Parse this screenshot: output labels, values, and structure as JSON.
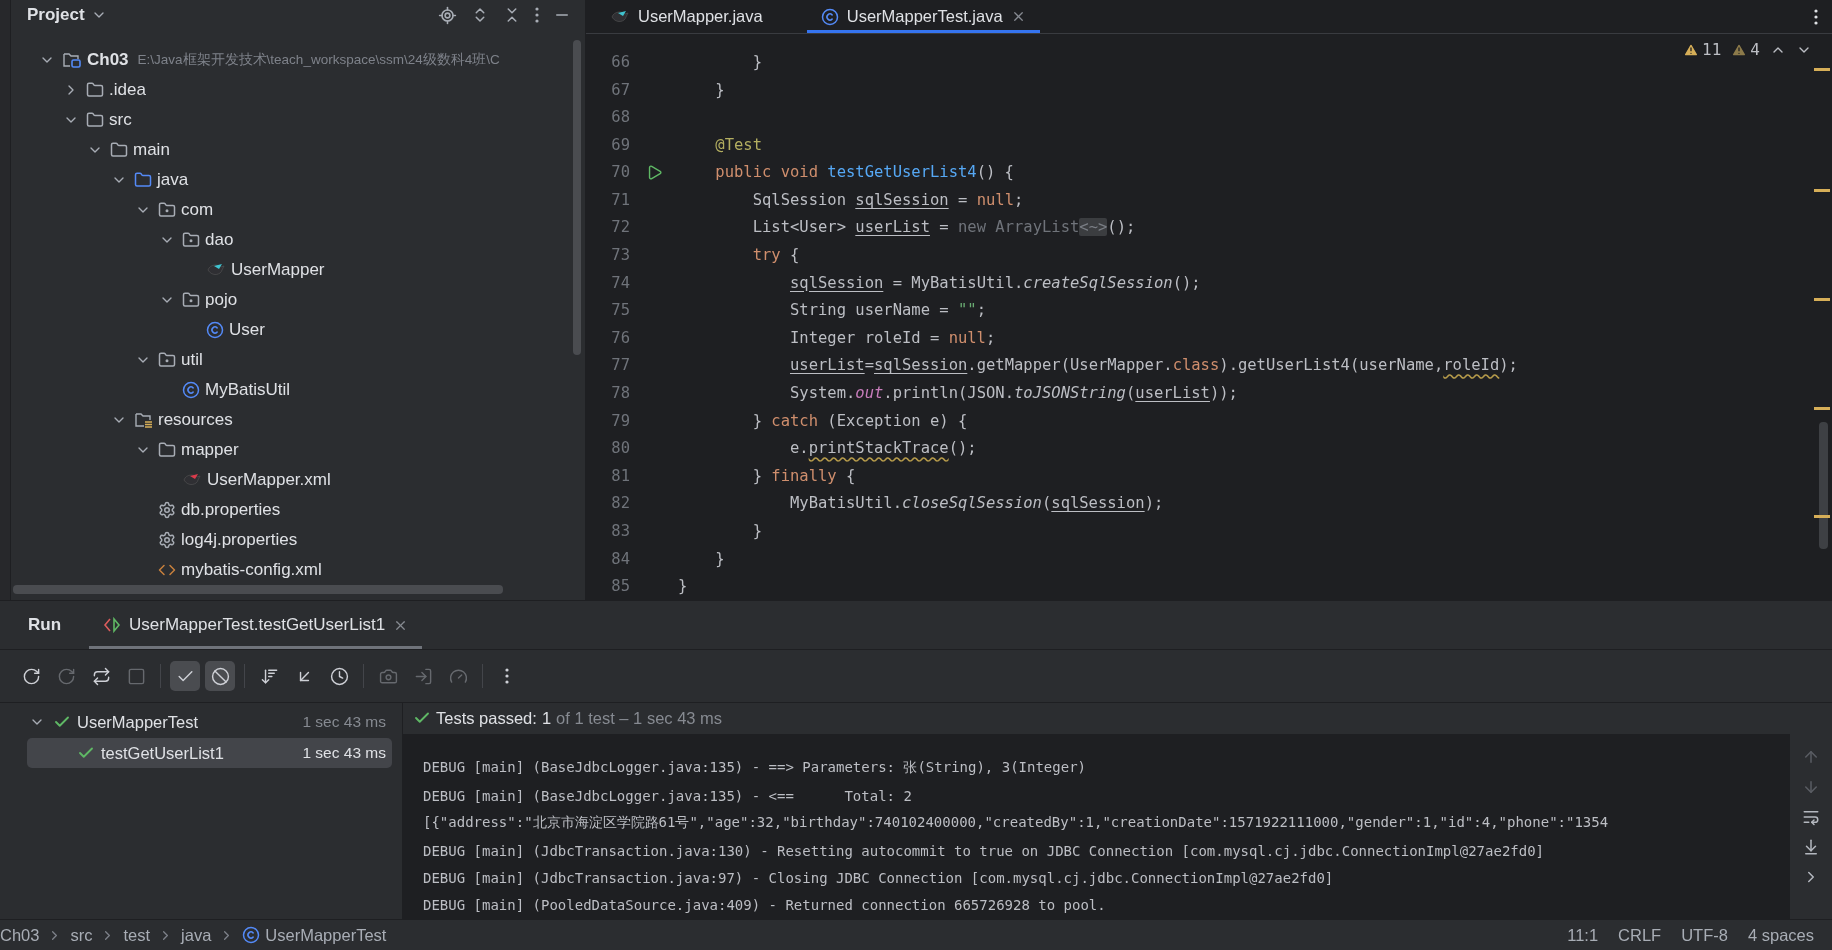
{
  "project": {
    "title": "Project",
    "tree": [
      {
        "label": "Ch03",
        "path": "E:\\Java框架开发技术\\teach_workspace\\ssm\\24级数科4班\\C",
        "kind": "module",
        "expanded": true,
        "children": [
          {
            "label": ".idea",
            "kind": "folder",
            "expanded": false
          },
          {
            "label": "src",
            "kind": "folder",
            "expanded": true,
            "children": [
              {
                "label": "main",
                "kind": "folder",
                "expanded": true,
                "children": [
                  {
                    "label": "java",
                    "kind": "source-folder",
                    "expanded": true,
                    "children": [
                      {
                        "label": "com",
                        "kind": "package",
                        "expanded": true,
                        "children": [
                          {
                            "label": "dao",
                            "kind": "package",
                            "expanded": true,
                            "children": [
                              {
                                "label": "UserMapper",
                                "kind": "mapper"
                              }
                            ]
                          },
                          {
                            "label": "pojo",
                            "kind": "package",
                            "expanded": true,
                            "children": [
                              {
                                "label": "User",
                                "kind": "class"
                              }
                            ]
                          }
                        ]
                      },
                      {
                        "label": "util",
                        "kind": "package",
                        "expanded": true,
                        "children": [
                          {
                            "label": "MyBatisUtil",
                            "kind": "class"
                          }
                        ]
                      }
                    ]
                  },
                  {
                    "label": "resources",
                    "kind": "resources",
                    "expanded": true,
                    "children": [
                      {
                        "label": "mapper",
                        "kind": "folder",
                        "expanded": true,
                        "children": [
                          {
                            "label": "UserMapper.xml",
                            "kind": "mapper-xml"
                          }
                        ]
                      },
                      {
                        "label": "db.properties",
                        "kind": "properties"
                      },
                      {
                        "label": "log4j.properties",
                        "kind": "properties"
                      },
                      {
                        "label": "mybatis-config.xml",
                        "kind": "xml"
                      }
                    ]
                  }
                ]
              }
            ]
          }
        ]
      }
    ]
  },
  "editor": {
    "tabs": [
      {
        "label": "UserMapper.java",
        "kind": "mapper",
        "selected": false,
        "closable": false
      },
      {
        "label": "UserMapperTest.java",
        "kind": "class",
        "selected": true,
        "closable": true
      }
    ],
    "inspections": {
      "warnings": "11",
      "weak_warnings": "4"
    },
    "lines": [
      {
        "number": "66",
        "run": false,
        "tokens": [
          {
            "kind": "plain",
            "text": "        }"
          }
        ]
      },
      {
        "number": "67",
        "run": false,
        "tokens": [
          {
            "kind": "plain",
            "text": "    }"
          }
        ]
      },
      {
        "number": "68",
        "run": false
      },
      {
        "number": "69",
        "run": false,
        "tokens": [
          {
            "kind": "annotation",
            "text": "    @Test"
          }
        ]
      },
      {
        "number": "70",
        "run": true,
        "tokens": [
          {
            "kind": "keyword",
            "text": "    public void "
          },
          {
            "kind": "method",
            "text": "testGetUserList4"
          },
          {
            "kind": "plain",
            "text": "() {"
          }
        ]
      },
      {
        "number": "71",
        "run": false,
        "tokens": [
          {
            "kind": "plain",
            "text": "        SqlSession "
          },
          {
            "kind": "local",
            "text": "sqlSession"
          },
          {
            "kind": "plain",
            "text": " = "
          },
          {
            "kind": "keyword",
            "text": "null"
          },
          {
            "kind": "plain",
            "text": ";"
          }
        ]
      },
      {
        "number": "72",
        "run": false,
        "tokens": [
          {
            "kind": "plain",
            "text": "        List<User> "
          },
          {
            "kind": "local",
            "text": "userList"
          },
          {
            "kind": "plain",
            "text": " = "
          },
          {
            "kind": "muted",
            "text": "new ArrayList"
          },
          {
            "kind": "hint",
            "text": "<~>"
          },
          {
            "kind": "plain",
            "text": "();"
          }
        ]
      },
      {
        "number": "73",
        "run": false,
        "tokens": [
          {
            "kind": "keyword",
            "text": "        try"
          },
          {
            "kind": "plain",
            "text": " {"
          }
        ]
      },
      {
        "number": "74",
        "run": false,
        "tokens": [
          {
            "kind": "local",
            "text": "            sqlSession"
          },
          {
            "kind": "plain",
            "text": " = MyBatisUtil."
          },
          {
            "kind": "italic",
            "text": "createSqlSession"
          },
          {
            "kind": "plain",
            "text": "();"
          }
        ]
      },
      {
        "number": "75",
        "run": false,
        "tokens": [
          {
            "kind": "plain",
            "text": "            String userName = "
          },
          {
            "kind": "string",
            "text": "\"\""
          },
          {
            "kind": "plain",
            "text": ";"
          }
        ]
      },
      {
        "number": "76",
        "run": false,
        "tokens": [
          {
            "kind": "plain",
            "text": "            Integer roleId = "
          },
          {
            "kind": "keyword",
            "text": "null"
          },
          {
            "kind": "plain",
            "text": ";"
          }
        ]
      },
      {
        "number": "77",
        "run": false,
        "tokens": [
          {
            "kind": "local",
            "text": "            userList"
          },
          {
            "kind": "plain",
            "text": "="
          },
          {
            "kind": "local",
            "text": "sqlSession"
          },
          {
            "kind": "plain",
            "text": ".getMapper(UserMapper."
          },
          {
            "kind": "keyword",
            "text": "class"
          },
          {
            "kind": "plain",
            "text": ").getUserList4(userName,"
          },
          {
            "kind": "warning",
            "text": "roleId"
          },
          {
            "kind": "plain",
            "text": ");"
          }
        ]
      },
      {
        "number": "78",
        "run": false,
        "tokens": [
          {
            "kind": "plain",
            "text": "            System."
          },
          {
            "kind": "static",
            "text": "out"
          },
          {
            "kind": "plain",
            "text": ".println(JSON."
          },
          {
            "kind": "italic",
            "text": "toJSONString"
          },
          {
            "kind": "plain",
            "text": "("
          },
          {
            "kind": "local",
            "text": "userList"
          },
          {
            "kind": "plain",
            "text": "));"
          }
        ]
      },
      {
        "number": "79",
        "run": false,
        "tokens": [
          {
            "kind": "plain",
            "text": "        } "
          },
          {
            "kind": "keyword",
            "text": "catch"
          },
          {
            "kind": "plain",
            "text": " (Exception e) {"
          }
        ]
      },
      {
        "number": "80",
        "run": false,
        "tokens": [
          {
            "kind": "plain",
            "text": "            e."
          },
          {
            "kind": "warning",
            "text": "printStackTrace"
          },
          {
            "kind": "plain",
            "text": "();"
          }
        ]
      },
      {
        "number": "81",
        "run": false,
        "tokens": [
          {
            "kind": "plain",
            "text": "        } "
          },
          {
            "kind": "keyword",
            "text": "finally"
          },
          {
            "kind": "plain",
            "text": " {"
          }
        ]
      },
      {
        "number": "82",
        "run": false,
        "tokens": [
          {
            "kind": "plain",
            "text": "            MyBatisUtil."
          },
          {
            "kind": "italic",
            "text": "closeSqlSession"
          },
          {
            "kind": "plain",
            "text": "("
          },
          {
            "kind": "local",
            "text": "sqlSession"
          },
          {
            "kind": "plain",
            "text": ");"
          }
        ]
      },
      {
        "number": "83",
        "run": false,
        "tokens": [
          {
            "kind": "plain",
            "text": "        }"
          }
        ]
      },
      {
        "number": "84",
        "run": false,
        "tokens": [
          {
            "kind": "plain",
            "text": "    }"
          }
        ]
      },
      {
        "number": "85",
        "run": false,
        "tokens": [
          {
            "kind": "plain",
            "text": "}"
          }
        ]
      }
    ]
  },
  "run": {
    "title": "Run",
    "tabs": [
      {
        "label": "UserMapperTest.testGetUserList1",
        "selected": true
      }
    ],
    "toolbar": [
      {
        "kind": "rerun",
        "disabled": false,
        "toggled": false
      },
      {
        "kind": "rerun-failed",
        "disabled": true,
        "toggled": false
      },
      {
        "kind": "auto-test",
        "disabled": false,
        "toggled": false
      },
      {
        "kind": "stop",
        "disabled": true,
        "toggled": false
      },
      {
        "kind": "show-passed",
        "disabled": false,
        "toggled": true
      },
      {
        "kind": "show-ignored",
        "disabled": false,
        "toggled": true
      },
      {
        "kind": "sort",
        "disabled": false,
        "toggled": false
      },
      {
        "kind": "import",
        "disabled": false,
        "toggled": false
      },
      {
        "kind": "history",
        "disabled": false,
        "toggled": false
      },
      {
        "kind": "snapshot",
        "disabled": true,
        "toggled": false
      },
      {
        "kind": "export",
        "disabled": true,
        "toggled": false
      },
      {
        "kind": "coverage",
        "disabled": true,
        "toggled": false
      },
      {
        "kind": "more",
        "disabled": false,
        "toggled": false
      }
    ],
    "tests": [
      {
        "name": "UserMapperTest",
        "time": "1 sec 43 ms",
        "passed": true,
        "expanded": true,
        "selected": false,
        "children": [
          {
            "name": "testGetUserList1",
            "time": "1 sec 43 ms",
            "passed": true,
            "selected": true
          }
        ]
      }
    ],
    "summary": {
      "label": "Tests passed:",
      "count": "1",
      "detail": "of 1 test – 1 sec 43 ms"
    },
    "console": [
      "DEBUG [main] (BaseJdbcLogger.java:135) - ==> Parameters: 张(String), 3(Integer)",
      "DEBUG [main] (BaseJdbcLogger.java:135) - <==      Total: 2",
      "[{\"address\":\"北京市海淀区学院路61号\",\"age\":32,\"birthday\":740102400000,\"createdBy\":1,\"creationDate\":1571922111000,\"gender\":1,\"id\":4,\"phone\":\"1354",
      "DEBUG [main] (JdbcTransaction.java:130) - Resetting autocommit to true on JDBC Connection [com.mysql.cj.jdbc.ConnectionImpl@27ae2fd0]",
      "DEBUG [main] (JdbcTransaction.java:97) - Closing JDBC Connection [com.mysql.cj.jdbc.ConnectionImpl@27ae2fd0]",
      "DEBUG [main] (PooledDataSource.java:409) - Returned connection 665726928 to pool."
    ]
  },
  "status_bar": {
    "breadcrumbs": [
      {
        "label": "Ch03"
      },
      {
        "label": "src"
      },
      {
        "label": "test"
      },
      {
        "label": "java"
      },
      {
        "label": "UserMapperTest",
        "kind": "class"
      }
    ],
    "items": [
      "11:1",
      "CRLF",
      "UTF-8",
      "4 spaces"
    ]
  }
}
